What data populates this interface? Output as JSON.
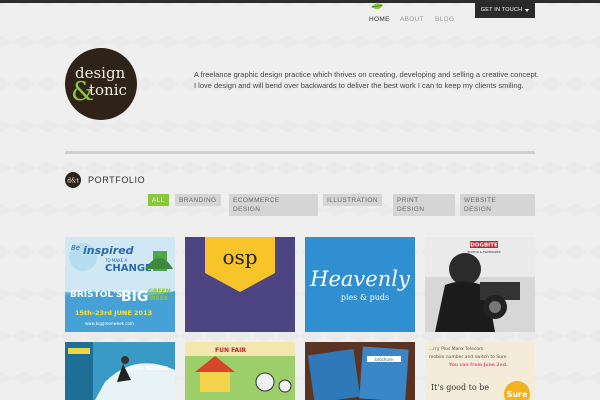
{
  "nav": {
    "items": [
      {
        "label": "HOME",
        "active": true
      },
      {
        "label": "ABOUT",
        "active": false
      },
      {
        "label": "BLOG",
        "active": false
      }
    ],
    "cta_label": "GET IN TOUCH"
  },
  "brand": {
    "logo_line1": "design",
    "logo_amp": "&",
    "logo_line2": "tonic",
    "icon": "leaf-icon"
  },
  "intro": "A freelance graphic design practice which thrives on creating, developing and selling a creative concept. I love design and will bend over backwards to deliver the best work I can to keep my clients smiling.",
  "portfolio": {
    "title": "PORTFOLIO",
    "icon_text": "d&t",
    "filters": [
      {
        "line1": "ALL",
        "line2": "",
        "active": true
      },
      {
        "line1": "BRANDING",
        "line2": "",
        "active": false
      },
      {
        "line1": "ECOMMERCE",
        "line2": "DESIGN",
        "active": false
      },
      {
        "line1": "ILLUSTRATION",
        "line2": "",
        "active": false
      },
      {
        "line1": "PRINT",
        "line2": "DESIGN",
        "active": false
      },
      {
        "line1": "WEBSITE",
        "line2": "DESIGN",
        "active": false
      }
    ],
    "thumbs": {
      "green_week": {
        "be": "Be",
        "inspired": "inspired",
        "to_make_a": "TO MAKE A",
        "change": "CHANGE",
        "bristols": "BRISTOL'S",
        "big": "BIG",
        "green": "GREEN",
        "week": "WEEK",
        "dates": "15th–23rd JUNE 2013",
        "url": "www.biggreenweek.com"
      },
      "osp": {
        "text": "osp"
      },
      "heavenly": {
        "title": "Heavenly",
        "subtitle": "pies & puds"
      },
      "dogbite": {
        "logo": "DOGBITE",
        "tagline": "EDITOR & FILMMAKER"
      },
      "surf": {
        "title": "SURF SCHOOL"
      },
      "fair": {
        "title": "FUN FAIR"
      },
      "brochure": {
        "text": "brochure"
      },
      "sure": {
        "line1": "...rry Plus Manx Telecom",
        "line2": "mobile number and switch to Sure",
        "line3": "You can from June 2nd.",
        "slogan": "It's good to be",
        "brand": "Sure"
      }
    }
  },
  "colors": {
    "accent_green": "#8ac73d",
    "dark": "#2a2a2a",
    "logo_bg": "#2f2218",
    "heavenly_blue": "#2f8fd0",
    "osp_purple": "#514a88",
    "osp_yellow": "#f7c52a"
  }
}
